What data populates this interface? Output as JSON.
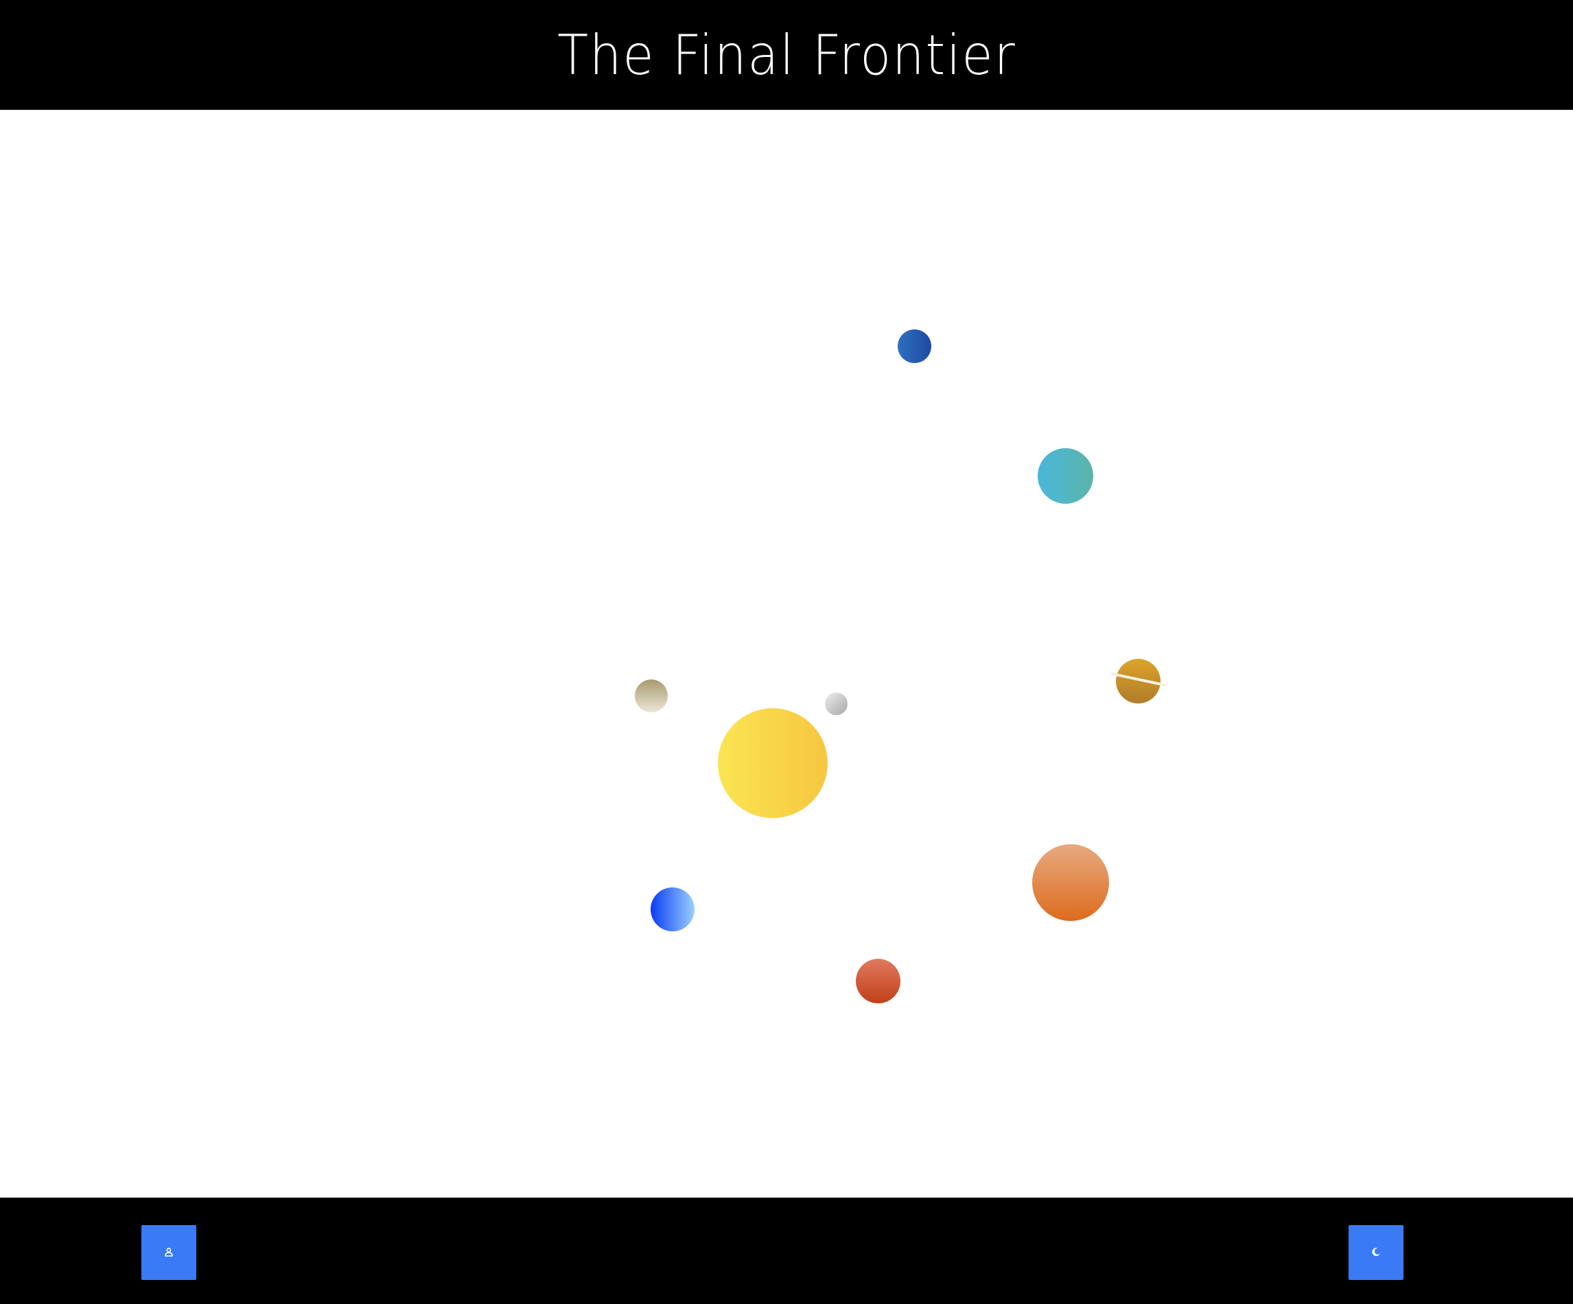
{
  "header": {
    "title": "The Final Frontier"
  },
  "colors": {
    "header_background": "#000000",
    "footer_background": "#000000",
    "button_background": "#3a7af5",
    "space_background": "#ffffff"
  },
  "space": {
    "bodies": [
      {
        "name": "sun",
        "color_from": "#fae552",
        "color_to": "#f6c640"
      },
      {
        "name": "navy-planet",
        "color_from": "#2f6fc0",
        "color_to": "#1e4aa0"
      },
      {
        "name": "teal-planet",
        "color_from": "#4ab6dc",
        "color_to": "#5ab5a8"
      },
      {
        "name": "ringed-planet",
        "color_from": "#dca42c",
        "color_to": "#b07c28"
      },
      {
        "name": "khaki-planet",
        "color_from": "#a89a70",
        "color_to": "#ece6d6"
      },
      {
        "name": "grey-planet",
        "color_from": "#eeeeee",
        "color_to": "#a6a6a6"
      },
      {
        "name": "orange-planet",
        "color_from": "#e8aa80",
        "color_to": "#dc6c1e"
      },
      {
        "name": "blue-planet",
        "color_from": "#0a3cf0",
        "color_to": "#9ad0ff"
      },
      {
        "name": "red-planet",
        "color_from": "#e07a5e",
        "color_to": "#c0401a"
      }
    ]
  },
  "footer": {
    "left_button": {
      "icon": "user-icon"
    },
    "right_button": {
      "icon": "moon-icon"
    }
  }
}
